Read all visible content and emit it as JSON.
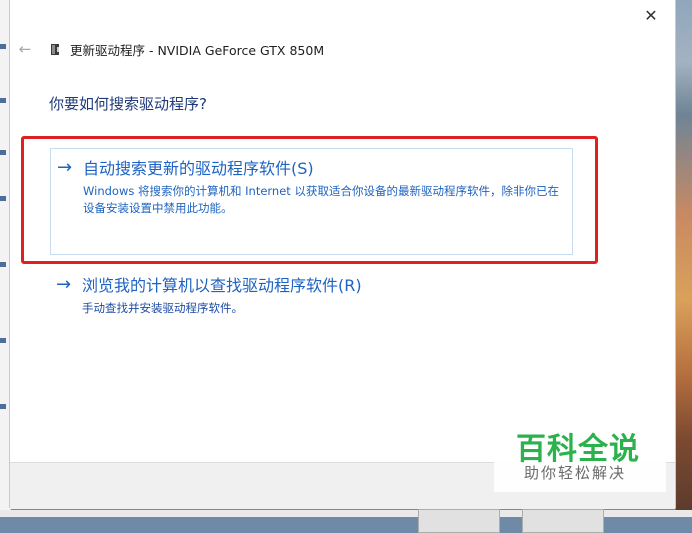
{
  "window": {
    "title": "更新驱动程序 - NVIDIA GeForce GTX 850M",
    "close_symbol": "✕",
    "back_symbol": "←"
  },
  "question": "你要如何搜索驱动程序?",
  "options": [
    {
      "arrow": "→",
      "title": "自动搜索更新的驱动程序软件(S)",
      "description": "Windows 将搜索你的计算机和 Internet 以获取适合你设备的最新驱动程序软件，除非你已在设备安装设置中禁用此功能。"
    },
    {
      "arrow": "→",
      "title": "浏览我的计算机以查找驱动程序软件(R)",
      "description": "手动查找并安装驱动程序软件。"
    }
  ],
  "highlight_color": "#e02020",
  "link_color": "#1e63c1",
  "watermark": {
    "title": "百科全说",
    "subtitle": "助你轻松解决",
    "color": "#2bb24c"
  },
  "icons": {
    "close": "close-icon",
    "back": "back-arrow-icon",
    "device": "device-icon",
    "option_arrow": "arrow-right-icon"
  }
}
